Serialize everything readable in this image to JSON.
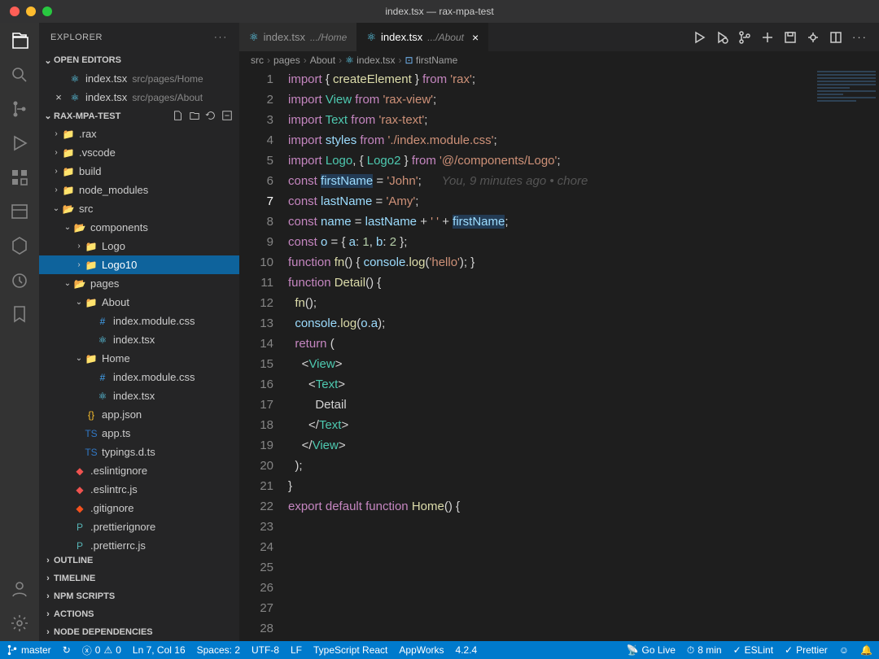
{
  "window": {
    "title": "index.tsx — rax-mpa-test"
  },
  "colors": {
    "red": "#ff5f57",
    "yellow": "#febc2e",
    "green": "#28c840"
  },
  "sidebar": {
    "title": "EXPLORER",
    "openEditors": {
      "label": "OPEN EDITORS",
      "items": [
        {
          "name": "index.tsx",
          "hint": "src/pages/Home",
          "close": ""
        },
        {
          "name": "index.tsx",
          "hint": "src/pages/About",
          "close": "×"
        }
      ]
    },
    "project": {
      "label": "RAX-MPA-TEST"
    },
    "bottomSections": [
      "OUTLINE",
      "TIMELINE",
      "NPM SCRIPTS",
      "ACTIONS",
      "NODE DEPENDENCIES"
    ],
    "tree": {
      "rax": ".rax",
      "vscode": ".vscode",
      "build": "build",
      "nodemodules": "node_modules",
      "src": "src",
      "components": "components",
      "logo": "Logo",
      "logo10": "Logo10",
      "pages": "pages",
      "about": "About",
      "home": "Home",
      "idxcss": "index.module.css",
      "idxtsx": "index.tsx",
      "appjson": "app.json",
      "appts": "app.ts",
      "typings": "typings.d.ts",
      "eslintignore": ".eslintignore",
      "eslintrc": ".eslintrc.js",
      "gitignore": ".gitignore",
      "prettierignore": ".prettierignore",
      "prettierrc": ".prettierrc.js"
    }
  },
  "tabs": [
    {
      "name": "index.tsx",
      "hint": ".../Home",
      "active": false
    },
    {
      "name": "index.tsx",
      "hint": ".../About",
      "active": true,
      "close": "×"
    }
  ],
  "breadcrumb": [
    "src",
    "pages",
    "About",
    "index.tsx",
    "firstName"
  ],
  "code": {
    "activeLine": 7,
    "blame": "You, 9 minutes ago • chore",
    "lines": [
      {
        "n": 1,
        "seg": [
          [
            "kw",
            "import"
          ],
          [
            "",
            " { "
          ],
          [
            "fn",
            "createElement"
          ],
          [
            "",
            " } "
          ],
          [
            "kw",
            "from"
          ],
          [
            "",
            " "
          ],
          [
            "str",
            "'rax'"
          ],
          [
            "",
            ";"
          ]
        ]
      },
      {
        "n": 2,
        "seg": [
          [
            "kw",
            "import"
          ],
          [
            "",
            " "
          ],
          [
            "cls",
            "View"
          ],
          [
            "",
            " "
          ],
          [
            "kw",
            "from"
          ],
          [
            "",
            " "
          ],
          [
            "str",
            "'rax-view'"
          ],
          [
            "",
            ";"
          ]
        ]
      },
      {
        "n": 3,
        "seg": [
          [
            "kw",
            "import"
          ],
          [
            "",
            " "
          ],
          [
            "cls",
            "Text"
          ],
          [
            "",
            " "
          ],
          [
            "kw",
            "from"
          ],
          [
            "",
            " "
          ],
          [
            "str",
            "'rax-text'"
          ],
          [
            "",
            ";"
          ]
        ]
      },
      {
        "n": 4,
        "seg": [
          [
            "kw",
            "import"
          ],
          [
            "",
            " "
          ],
          [
            "var",
            "styles"
          ],
          [
            "",
            " "
          ],
          [
            "kw",
            "from"
          ],
          [
            "",
            " "
          ],
          [
            "str",
            "'./index.module.css'"
          ],
          [
            "",
            ";"
          ]
        ]
      },
      {
        "n": 5,
        "seg": [
          [
            "kw",
            "import"
          ],
          [
            "",
            " "
          ],
          [
            "cls",
            "Logo"
          ],
          [
            "",
            ", { "
          ],
          [
            "cls",
            "Logo2"
          ],
          [
            "",
            " } "
          ],
          [
            "kw",
            "from"
          ],
          [
            "",
            " "
          ],
          [
            "str",
            "'@/components/Logo'"
          ],
          [
            "",
            ";"
          ]
        ]
      },
      {
        "n": 6,
        "seg": [
          [
            "",
            ""
          ]
        ]
      },
      {
        "n": 7,
        "seg": [
          [
            "kw",
            "const"
          ],
          [
            "",
            " "
          ],
          [
            "var sel",
            "firstName"
          ],
          [
            "",
            " = "
          ],
          [
            "str",
            "'John'"
          ],
          [
            "",
            ";"
          ]
        ]
      },
      {
        "n": 8,
        "seg": [
          [
            "kw",
            "const"
          ],
          [
            "",
            " "
          ],
          [
            "var",
            "lastName"
          ],
          [
            "",
            " = "
          ],
          [
            "str",
            "'Amy'"
          ],
          [
            "",
            ";"
          ]
        ]
      },
      {
        "n": 9,
        "seg": [
          [
            "",
            ""
          ]
        ]
      },
      {
        "n": 10,
        "seg": [
          [
            "kw",
            "const"
          ],
          [
            "",
            " "
          ],
          [
            "var",
            "name"
          ],
          [
            "",
            " = "
          ],
          [
            "var",
            "lastName"
          ],
          [
            "",
            " + "
          ],
          [
            "str",
            "' '"
          ],
          [
            "",
            " + "
          ],
          [
            "var sel",
            "firstName"
          ],
          [
            "",
            ";"
          ]
        ]
      },
      {
        "n": 11,
        "seg": [
          [
            "",
            ""
          ]
        ]
      },
      {
        "n": 12,
        "seg": [
          [
            "kw",
            "const"
          ],
          [
            "",
            " "
          ],
          [
            "var",
            "o"
          ],
          [
            "",
            " = { "
          ],
          [
            "var",
            "a"
          ],
          [
            "",
            ": "
          ],
          [
            "num",
            "1"
          ],
          [
            "",
            ", "
          ],
          [
            "var",
            "b"
          ],
          [
            "",
            ": "
          ],
          [
            "num",
            "2"
          ],
          [
            "",
            " };"
          ]
        ]
      },
      {
        "n": 13,
        "seg": [
          [
            "",
            ""
          ]
        ]
      },
      {
        "n": 14,
        "seg": [
          [
            "kw",
            "function"
          ],
          [
            "",
            " "
          ],
          [
            "fn",
            "fn"
          ],
          [
            "",
            "() { "
          ],
          [
            "var",
            "console"
          ],
          [
            "",
            "."
          ],
          [
            "fn",
            "log"
          ],
          [
            "",
            "("
          ],
          [
            "str",
            "'hello'"
          ],
          [
            "",
            "); }"
          ]
        ]
      },
      {
        "n": 15,
        "seg": [
          [
            "",
            ""
          ]
        ]
      },
      {
        "n": 16,
        "seg": [
          [
            "kw",
            "function"
          ],
          [
            "",
            " "
          ],
          [
            "fn",
            "Detail"
          ],
          [
            "",
            "() {"
          ]
        ]
      },
      {
        "n": 17,
        "seg": [
          [
            "",
            "  "
          ],
          [
            "fn",
            "fn"
          ],
          [
            "",
            "();"
          ]
        ]
      },
      {
        "n": 18,
        "seg": [
          [
            "",
            "  "
          ],
          [
            "var",
            "console"
          ],
          [
            "",
            "."
          ],
          [
            "fn",
            "log"
          ],
          [
            "",
            "("
          ],
          [
            "var",
            "o"
          ],
          [
            "",
            "."
          ],
          [
            "var",
            "a"
          ],
          [
            "",
            ");"
          ]
        ]
      },
      {
        "n": 19,
        "seg": [
          [
            "",
            "  "
          ],
          [
            "kw",
            "return"
          ],
          [
            "",
            " ("
          ]
        ]
      },
      {
        "n": 20,
        "seg": [
          [
            "",
            "    <"
          ],
          [
            "cls",
            "View"
          ],
          [
            "",
            ">"
          ]
        ]
      },
      {
        "n": 21,
        "seg": [
          [
            "",
            "      <"
          ],
          [
            "cls",
            "Text"
          ],
          [
            "",
            ">"
          ]
        ]
      },
      {
        "n": 22,
        "seg": [
          [
            "",
            "        Detail"
          ]
        ]
      },
      {
        "n": 23,
        "seg": [
          [
            "",
            "      </"
          ],
          [
            "cls",
            "Text"
          ],
          [
            "",
            ">"
          ]
        ]
      },
      {
        "n": 24,
        "seg": [
          [
            "",
            "    </"
          ],
          [
            "cls",
            "View"
          ],
          [
            "",
            ">"
          ]
        ]
      },
      {
        "n": 25,
        "seg": [
          [
            "",
            "  );"
          ]
        ]
      },
      {
        "n": 26,
        "seg": [
          [
            "",
            "}"
          ]
        ]
      },
      {
        "n": 27,
        "seg": [
          [
            "",
            ""
          ]
        ]
      },
      {
        "n": 28,
        "seg": [
          [
            "kw",
            "export"
          ],
          [
            "",
            " "
          ],
          [
            "kw",
            "default"
          ],
          [
            "",
            " "
          ],
          [
            "kw",
            "function"
          ],
          [
            "",
            " "
          ],
          [
            "fn",
            "Home"
          ],
          [
            "",
            "() {"
          ]
        ]
      }
    ]
  },
  "status": {
    "branch": "master",
    "sync": "↻",
    "errors": "0",
    "warnings": "0",
    "cursor": "Ln 7, Col 16",
    "spaces": "Spaces: 2",
    "enc": "UTF-8",
    "eol": "LF",
    "lang": "TypeScript React",
    "appworks": "AppWorks",
    "version": "4.2.4",
    "golive": "Go Live",
    "time": "8 min",
    "eslint": "ESLint",
    "prettier": "Prettier"
  }
}
